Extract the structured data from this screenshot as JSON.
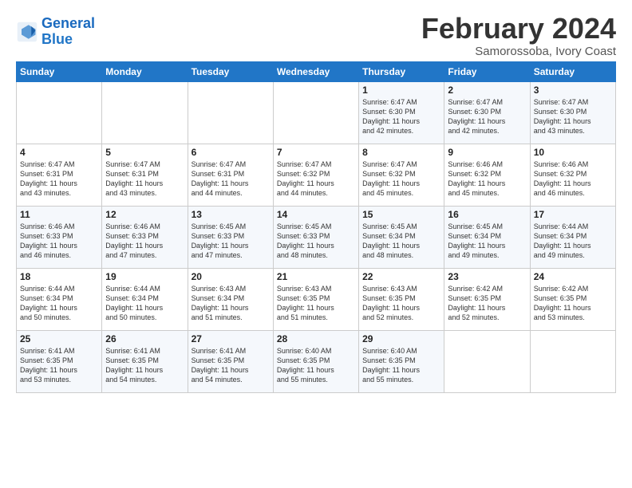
{
  "logo": {
    "line1": "General",
    "line2": "Blue"
  },
  "title": "February 2024",
  "location": "Samorossoba, Ivory Coast",
  "header": {
    "days": [
      "Sunday",
      "Monday",
      "Tuesday",
      "Wednesday",
      "Thursday",
      "Friday",
      "Saturday"
    ]
  },
  "weeks": [
    [
      {
        "day": "",
        "text": ""
      },
      {
        "day": "",
        "text": ""
      },
      {
        "day": "",
        "text": ""
      },
      {
        "day": "",
        "text": ""
      },
      {
        "day": "1",
        "text": "Sunrise: 6:47 AM\nSunset: 6:30 PM\nDaylight: 11 hours\nand 42 minutes."
      },
      {
        "day": "2",
        "text": "Sunrise: 6:47 AM\nSunset: 6:30 PM\nDaylight: 11 hours\nand 42 minutes."
      },
      {
        "day": "3",
        "text": "Sunrise: 6:47 AM\nSunset: 6:30 PM\nDaylight: 11 hours\nand 43 minutes."
      }
    ],
    [
      {
        "day": "4",
        "text": "Sunrise: 6:47 AM\nSunset: 6:31 PM\nDaylight: 11 hours\nand 43 minutes."
      },
      {
        "day": "5",
        "text": "Sunrise: 6:47 AM\nSunset: 6:31 PM\nDaylight: 11 hours\nand 43 minutes."
      },
      {
        "day": "6",
        "text": "Sunrise: 6:47 AM\nSunset: 6:31 PM\nDaylight: 11 hours\nand 44 minutes."
      },
      {
        "day": "7",
        "text": "Sunrise: 6:47 AM\nSunset: 6:32 PM\nDaylight: 11 hours\nand 44 minutes."
      },
      {
        "day": "8",
        "text": "Sunrise: 6:47 AM\nSunset: 6:32 PM\nDaylight: 11 hours\nand 45 minutes."
      },
      {
        "day": "9",
        "text": "Sunrise: 6:46 AM\nSunset: 6:32 PM\nDaylight: 11 hours\nand 45 minutes."
      },
      {
        "day": "10",
        "text": "Sunrise: 6:46 AM\nSunset: 6:32 PM\nDaylight: 11 hours\nand 46 minutes."
      }
    ],
    [
      {
        "day": "11",
        "text": "Sunrise: 6:46 AM\nSunset: 6:33 PM\nDaylight: 11 hours\nand 46 minutes."
      },
      {
        "day": "12",
        "text": "Sunrise: 6:46 AM\nSunset: 6:33 PM\nDaylight: 11 hours\nand 47 minutes."
      },
      {
        "day": "13",
        "text": "Sunrise: 6:45 AM\nSunset: 6:33 PM\nDaylight: 11 hours\nand 47 minutes."
      },
      {
        "day": "14",
        "text": "Sunrise: 6:45 AM\nSunset: 6:33 PM\nDaylight: 11 hours\nand 48 minutes."
      },
      {
        "day": "15",
        "text": "Sunrise: 6:45 AM\nSunset: 6:34 PM\nDaylight: 11 hours\nand 48 minutes."
      },
      {
        "day": "16",
        "text": "Sunrise: 6:45 AM\nSunset: 6:34 PM\nDaylight: 11 hours\nand 49 minutes."
      },
      {
        "day": "17",
        "text": "Sunrise: 6:44 AM\nSunset: 6:34 PM\nDaylight: 11 hours\nand 49 minutes."
      }
    ],
    [
      {
        "day": "18",
        "text": "Sunrise: 6:44 AM\nSunset: 6:34 PM\nDaylight: 11 hours\nand 50 minutes."
      },
      {
        "day": "19",
        "text": "Sunrise: 6:44 AM\nSunset: 6:34 PM\nDaylight: 11 hours\nand 50 minutes."
      },
      {
        "day": "20",
        "text": "Sunrise: 6:43 AM\nSunset: 6:34 PM\nDaylight: 11 hours\nand 51 minutes."
      },
      {
        "day": "21",
        "text": "Sunrise: 6:43 AM\nSunset: 6:35 PM\nDaylight: 11 hours\nand 51 minutes."
      },
      {
        "day": "22",
        "text": "Sunrise: 6:43 AM\nSunset: 6:35 PM\nDaylight: 11 hours\nand 52 minutes."
      },
      {
        "day": "23",
        "text": "Sunrise: 6:42 AM\nSunset: 6:35 PM\nDaylight: 11 hours\nand 52 minutes."
      },
      {
        "day": "24",
        "text": "Sunrise: 6:42 AM\nSunset: 6:35 PM\nDaylight: 11 hours\nand 53 minutes."
      }
    ],
    [
      {
        "day": "25",
        "text": "Sunrise: 6:41 AM\nSunset: 6:35 PM\nDaylight: 11 hours\nand 53 minutes."
      },
      {
        "day": "26",
        "text": "Sunrise: 6:41 AM\nSunset: 6:35 PM\nDaylight: 11 hours\nand 54 minutes."
      },
      {
        "day": "27",
        "text": "Sunrise: 6:41 AM\nSunset: 6:35 PM\nDaylight: 11 hours\nand 54 minutes."
      },
      {
        "day": "28",
        "text": "Sunrise: 6:40 AM\nSunset: 6:35 PM\nDaylight: 11 hours\nand 55 minutes."
      },
      {
        "day": "29",
        "text": "Sunrise: 6:40 AM\nSunset: 6:35 PM\nDaylight: 11 hours\nand 55 minutes."
      },
      {
        "day": "",
        "text": ""
      },
      {
        "day": "",
        "text": ""
      }
    ]
  ]
}
